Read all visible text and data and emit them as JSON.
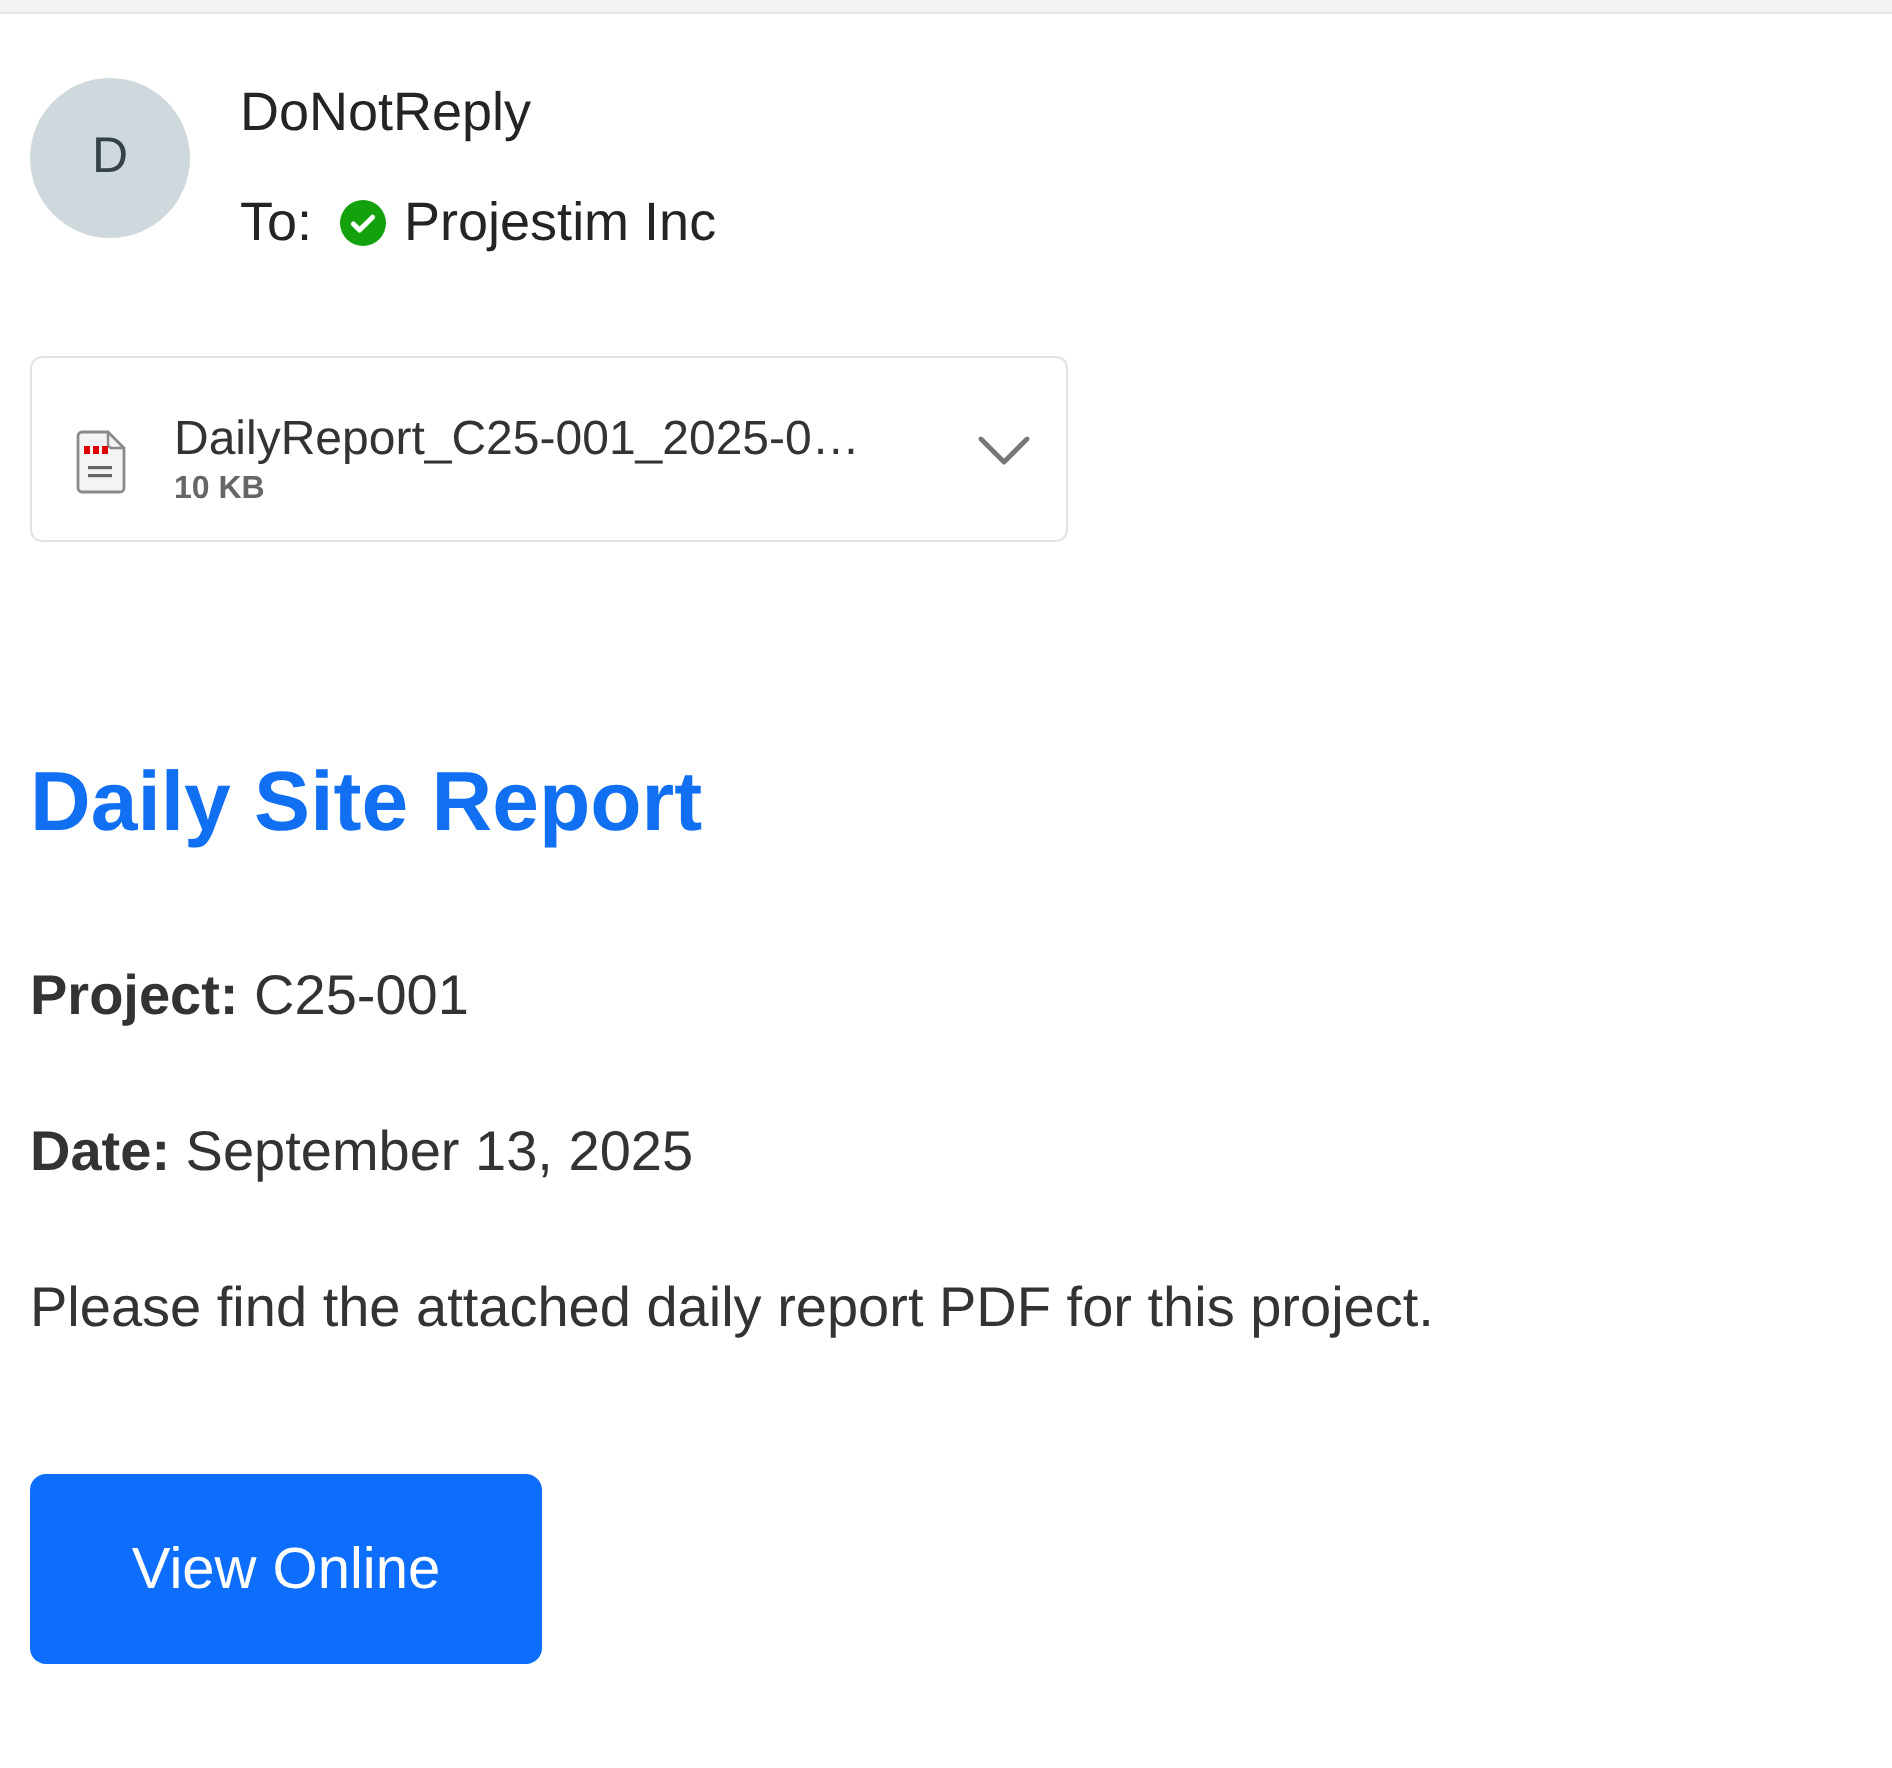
{
  "sender": {
    "avatar_initial": "D",
    "name": "DoNotReply",
    "to_label": "To:",
    "recipient": "Projestim Inc",
    "recipient_verified": true
  },
  "attachment": {
    "file_name": "DailyReport_C25-001_2025-0…",
    "size": "10 KB"
  },
  "body": {
    "heading": "Daily Site Report",
    "lines": [
      "**Project:** C25-001",
      "**Date:** September 13, 2025",
      "Please find the attached daily report PDF for this project."
    ],
    "button": "View Online"
  }
}
